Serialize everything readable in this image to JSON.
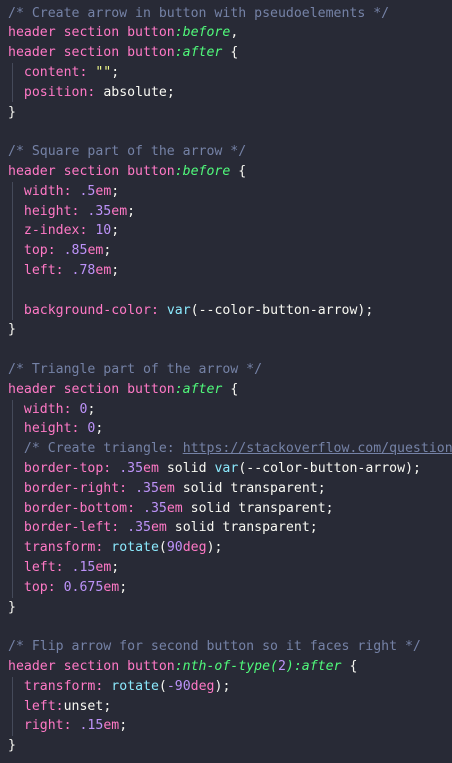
{
  "code": {
    "lines": [
      [
        {
          "t": "/* Create arrow in button with pseudoelements */",
          "c": "comment"
        }
      ],
      [
        {
          "t": "header section button",
          "c": "selector"
        },
        {
          "t": ":before",
          "c": "pseudo"
        },
        {
          "t": ",",
          "c": "brace"
        }
      ],
      [
        {
          "t": "header section button",
          "c": "selector"
        },
        {
          "t": ":after",
          "c": "pseudo"
        },
        {
          "t": " {",
          "c": "brace"
        }
      ],
      [
        {
          "t": "  "
        },
        {
          "t": "content",
          "c": "prop"
        },
        {
          "t": ": ",
          "c": "colon"
        },
        {
          "t": "\"\"",
          "c": "string"
        },
        {
          "t": ";",
          "c": "punct"
        }
      ],
      [
        {
          "t": "  "
        },
        {
          "t": "position",
          "c": "prop"
        },
        {
          "t": ": ",
          "c": "colon"
        },
        {
          "t": "absolute",
          "c": "value"
        },
        {
          "t": ";",
          "c": "punct"
        }
      ],
      [
        {
          "t": "}",
          "c": "brace"
        }
      ],
      [],
      [
        {
          "t": "/* Square part of the arrow */",
          "c": "comment"
        }
      ],
      [
        {
          "t": "header section button",
          "c": "selector"
        },
        {
          "t": ":before",
          "c": "pseudo"
        },
        {
          "t": " {",
          "c": "brace"
        }
      ],
      [
        {
          "t": "  "
        },
        {
          "t": "width",
          "c": "prop"
        },
        {
          "t": ": ",
          "c": "colon"
        },
        {
          "t": ".5",
          "c": "number"
        },
        {
          "t": "em",
          "c": "unit"
        },
        {
          "t": ";",
          "c": "punct"
        }
      ],
      [
        {
          "t": "  "
        },
        {
          "t": "height",
          "c": "prop"
        },
        {
          "t": ": ",
          "c": "colon"
        },
        {
          "t": ".35",
          "c": "number"
        },
        {
          "t": "em",
          "c": "unit"
        },
        {
          "t": ";",
          "c": "punct"
        }
      ],
      [
        {
          "t": "  "
        },
        {
          "t": "z-index",
          "c": "prop"
        },
        {
          "t": ": ",
          "c": "colon"
        },
        {
          "t": "10",
          "c": "number"
        },
        {
          "t": ";",
          "c": "punct"
        }
      ],
      [
        {
          "t": "  "
        },
        {
          "t": "top",
          "c": "prop"
        },
        {
          "t": ": ",
          "c": "colon"
        },
        {
          "t": ".85",
          "c": "number"
        },
        {
          "t": "em",
          "c": "unit"
        },
        {
          "t": ";",
          "c": "punct"
        }
      ],
      [
        {
          "t": "  "
        },
        {
          "t": "left",
          "c": "prop"
        },
        {
          "t": ": ",
          "c": "colon"
        },
        {
          "t": ".78",
          "c": "number"
        },
        {
          "t": "em",
          "c": "unit"
        },
        {
          "t": ";",
          "c": "punct"
        }
      ],
      [],
      [
        {
          "t": "  "
        },
        {
          "t": "background-color",
          "c": "prop"
        },
        {
          "t": ": ",
          "c": "colon"
        },
        {
          "t": "var",
          "c": "func"
        },
        {
          "t": "(",
          "c": "punct"
        },
        {
          "t": "--color-button-arrow",
          "c": "var"
        },
        {
          "t": ")",
          "c": "punct"
        },
        {
          "t": ";",
          "c": "punct"
        }
      ],
      [
        {
          "t": "}",
          "c": "brace"
        }
      ],
      [],
      [
        {
          "t": "/* Triangle part of the arrow */",
          "c": "comment"
        }
      ],
      [
        {
          "t": "header section button",
          "c": "selector"
        },
        {
          "t": ":after",
          "c": "pseudo"
        },
        {
          "t": " {",
          "c": "brace"
        }
      ],
      [
        {
          "t": "  "
        },
        {
          "t": "width",
          "c": "prop"
        },
        {
          "t": ": ",
          "c": "colon"
        },
        {
          "t": "0",
          "c": "number"
        },
        {
          "t": ";",
          "c": "punct"
        }
      ],
      [
        {
          "t": "  "
        },
        {
          "t": "height",
          "c": "prop"
        },
        {
          "t": ": ",
          "c": "colon"
        },
        {
          "t": "0",
          "c": "number"
        },
        {
          "t": ";",
          "c": "punct"
        }
      ],
      [
        {
          "t": "  "
        },
        {
          "t": "/* Create triangle: ",
          "c": "comment"
        },
        {
          "t": "https://stackoverflow.com/question",
          "c": "link"
        }
      ],
      [
        {
          "t": "  "
        },
        {
          "t": "border-top",
          "c": "prop"
        },
        {
          "t": ": ",
          "c": "colon"
        },
        {
          "t": ".35",
          "c": "number"
        },
        {
          "t": "em",
          "c": "unit"
        },
        {
          "t": " solid ",
          "c": "value"
        },
        {
          "t": "var",
          "c": "func"
        },
        {
          "t": "(",
          "c": "punct"
        },
        {
          "t": "--color-button-arrow",
          "c": "var"
        },
        {
          "t": ")",
          "c": "punct"
        },
        {
          "t": ";",
          "c": "punct"
        }
      ],
      [
        {
          "t": "  "
        },
        {
          "t": "border-right",
          "c": "prop"
        },
        {
          "t": ": ",
          "c": "colon"
        },
        {
          "t": ".35",
          "c": "number"
        },
        {
          "t": "em",
          "c": "unit"
        },
        {
          "t": " solid transparent",
          "c": "value"
        },
        {
          "t": ";",
          "c": "punct"
        }
      ],
      [
        {
          "t": "  "
        },
        {
          "t": "border-bottom",
          "c": "prop"
        },
        {
          "t": ": ",
          "c": "colon"
        },
        {
          "t": ".35",
          "c": "number"
        },
        {
          "t": "em",
          "c": "unit"
        },
        {
          "t": " solid transparent",
          "c": "value"
        },
        {
          "t": ";",
          "c": "punct"
        }
      ],
      [
        {
          "t": "  "
        },
        {
          "t": "border-left",
          "c": "prop"
        },
        {
          "t": ": ",
          "c": "colon"
        },
        {
          "t": ".35",
          "c": "number"
        },
        {
          "t": "em",
          "c": "unit"
        },
        {
          "t": " solid transparent",
          "c": "value"
        },
        {
          "t": ";",
          "c": "punct"
        }
      ],
      [
        {
          "t": "  "
        },
        {
          "t": "transform",
          "c": "prop"
        },
        {
          "t": ": ",
          "c": "colon"
        },
        {
          "t": "rotate",
          "c": "func"
        },
        {
          "t": "(",
          "c": "punct"
        },
        {
          "t": "90",
          "c": "number"
        },
        {
          "t": "deg",
          "c": "unit"
        },
        {
          "t": ")",
          "c": "punct"
        },
        {
          "t": ";",
          "c": "punct"
        }
      ],
      [
        {
          "t": "  "
        },
        {
          "t": "left",
          "c": "prop"
        },
        {
          "t": ": ",
          "c": "colon"
        },
        {
          "t": ".15",
          "c": "number"
        },
        {
          "t": "em",
          "c": "unit"
        },
        {
          "t": ";",
          "c": "punct"
        }
      ],
      [
        {
          "t": "  "
        },
        {
          "t": "top",
          "c": "prop"
        },
        {
          "t": ": ",
          "c": "colon"
        },
        {
          "t": "0.675",
          "c": "number"
        },
        {
          "t": "em",
          "c": "unit"
        },
        {
          "t": ";",
          "c": "punct"
        }
      ],
      [
        {
          "t": "}",
          "c": "brace"
        }
      ],
      [],
      [
        {
          "t": "/* Flip arrow for second button so it faces right */",
          "c": "comment"
        }
      ],
      [
        {
          "t": "header section button",
          "c": "selector"
        },
        {
          "t": ":nth-of-type(",
          "c": "pseudo"
        },
        {
          "t": "2",
          "c": "number"
        },
        {
          "t": ")",
          "c": "pseudo"
        },
        {
          "t": ":after",
          "c": "pseudo"
        },
        {
          "t": " {",
          "c": "brace"
        }
      ],
      [
        {
          "t": "  "
        },
        {
          "t": "transform",
          "c": "prop"
        },
        {
          "t": ": ",
          "c": "colon"
        },
        {
          "t": "rotate",
          "c": "func"
        },
        {
          "t": "(",
          "c": "punct"
        },
        {
          "t": "-90",
          "c": "number"
        },
        {
          "t": "deg",
          "c": "unit"
        },
        {
          "t": ")",
          "c": "punct"
        },
        {
          "t": ";",
          "c": "punct"
        }
      ],
      [
        {
          "t": "  "
        },
        {
          "t": "left",
          "c": "prop"
        },
        {
          "t": ":",
          "c": "colon"
        },
        {
          "t": "unset",
          "c": "value"
        },
        {
          "t": ";",
          "c": "punct"
        }
      ],
      [
        {
          "t": "  "
        },
        {
          "t": "right",
          "c": "prop"
        },
        {
          "t": ": ",
          "c": "colon"
        },
        {
          "t": ".15",
          "c": "number"
        },
        {
          "t": "em",
          "c": "unit"
        },
        {
          "t": ";",
          "c": "punct"
        }
      ],
      [
        {
          "t": "}",
          "c": "brace"
        }
      ]
    ]
  },
  "theme": {
    "background": "#282a36",
    "comment": "#7582a6",
    "selector": "#ff79c6",
    "pseudo": "#50fa7b",
    "number": "#bd93f9",
    "string": "#f1fa8c",
    "function": "#8be9fd",
    "text": "#f8f8f2"
  }
}
